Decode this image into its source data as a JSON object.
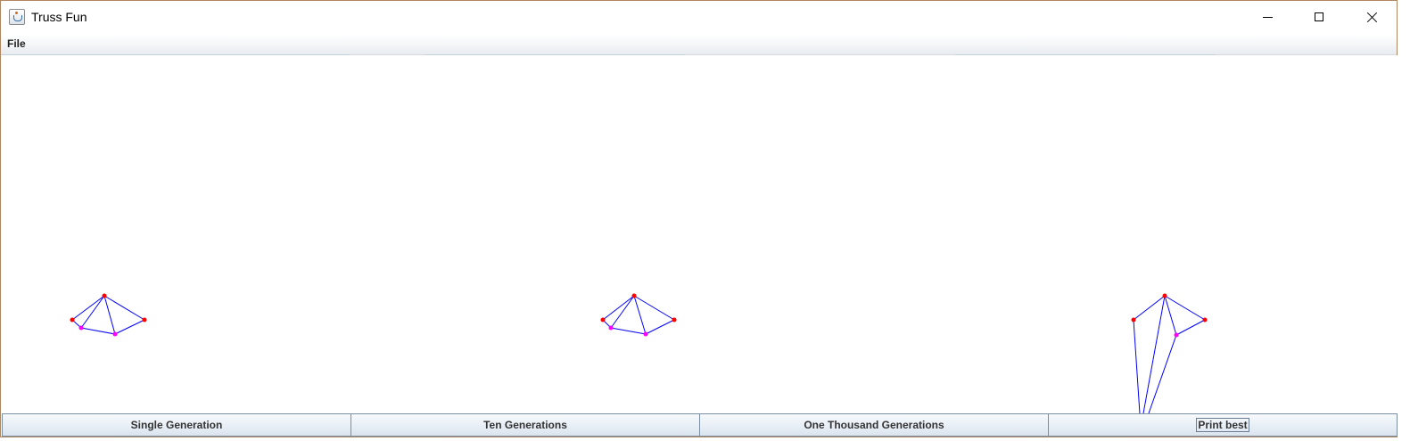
{
  "window": {
    "title": "Truss Fun",
    "icon": "java-app-icon",
    "controls": [
      "minimize-icon",
      "maximize-icon",
      "close-icon"
    ]
  },
  "menu": {
    "items": [
      {
        "label": "File"
      }
    ]
  },
  "canvas": {
    "background": "#ffffff",
    "truss_count": 3,
    "colors": {
      "member": "#0000ff",
      "fixed_node": "#ff0000",
      "free_node": "#ff00ff"
    }
  },
  "buttons": [
    {
      "label": "Single Generation"
    },
    {
      "label": "Ten Generations"
    },
    {
      "label": "One Thousand Generations"
    },
    {
      "label": "Print best",
      "focused": true
    }
  ],
  "colors": {
    "window_border": "#b08660",
    "button_border": "#7a8ea4"
  }
}
